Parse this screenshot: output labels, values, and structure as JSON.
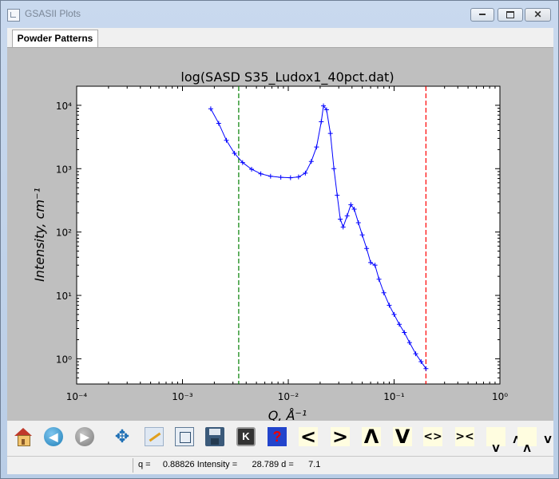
{
  "window": {
    "title": "GSASII Plots"
  },
  "tabs": [
    {
      "label": "Powder Patterns",
      "active": true
    }
  ],
  "status": {
    "text": "q =     0.88826 Intensity =      28.789 d =      7.1"
  },
  "toolbar": {
    "buttons": [
      {
        "name": "home-icon"
      },
      {
        "name": "back-icon"
      },
      {
        "name": "forward-icon"
      },
      {
        "name": "pan-icon"
      },
      {
        "name": "edit-icon"
      },
      {
        "name": "subplots-icon"
      },
      {
        "name": "save-icon"
      },
      {
        "name": "key-icon"
      },
      {
        "name": "help-icon"
      },
      {
        "name": "left-icon",
        "symbol": "<"
      },
      {
        "name": "right-icon",
        "symbol": ">"
      },
      {
        "name": "up-icon",
        "symbol": "Λ"
      },
      {
        "name": "down-icon",
        "symbol": "V"
      },
      {
        "name": "expand-icon",
        "symbol": "<>"
      },
      {
        "name": "shrink-icon",
        "symbol": "><"
      },
      {
        "name": "vexpand-icon",
        "symbol": "Λ\nV"
      },
      {
        "name": "vshrink-icon",
        "symbol": "V\nΛ"
      }
    ],
    "key_label": "K",
    "help_label": "?"
  },
  "chart_data": {
    "type": "line",
    "title": "log(SASD S35_Ludox1_40pct.dat)",
    "xlabel": "Q, Å⁻¹",
    "ylabel": "Intensity, cm⁻¹",
    "xscale": "log",
    "yscale": "log",
    "xlim": [
      0.0001,
      1
    ],
    "ylim": [
      0.4,
      20000
    ],
    "xticks": [
      {
        "value": 0.0001,
        "label": "10⁻⁴"
      },
      {
        "value": 0.001,
        "label": "10⁻³"
      },
      {
        "value": 0.01,
        "label": "10⁻²"
      },
      {
        "value": 0.1,
        "label": "10⁻¹"
      },
      {
        "value": 1,
        "label": "10⁰"
      }
    ],
    "yticks": [
      {
        "value": 1,
        "label": "10⁰"
      },
      {
        "value": 10,
        "label": "10¹"
      },
      {
        "value": 100,
        "label": "10²"
      },
      {
        "value": 1000,
        "label": "10³"
      },
      {
        "value": 10000,
        "label": "10⁴"
      }
    ],
    "series_color": "#0000ff",
    "markers": "+",
    "vlines": [
      {
        "x": 0.0034,
        "color": "#007f00",
        "style": "dashed"
      },
      {
        "x": 0.2,
        "color": "#ff0000",
        "style": "dashed"
      }
    ],
    "x": [
      0.00185,
      0.0022,
      0.0026,
      0.0031,
      0.0037,
      0.0045,
      0.0055,
      0.0068,
      0.0085,
      0.0105,
      0.0125,
      0.0145,
      0.0165,
      0.0185,
      0.0205,
      0.0215,
      0.023,
      0.025,
      0.027,
      0.029,
      0.031,
      0.033,
      0.036,
      0.039,
      0.042,
      0.046,
      0.05,
      0.055,
      0.06,
      0.066,
      0.072,
      0.08,
      0.09,
      0.1,
      0.112,
      0.125,
      0.14,
      0.16,
      0.18,
      0.2
    ],
    "y": [
      8800,
      5200,
      2800,
      1750,
      1250,
      980,
      830,
      760,
      730,
      720,
      740,
      850,
      1300,
      2200,
      5500,
      9800,
      8500,
      3600,
      1000,
      380,
      160,
      120,
      180,
      270,
      230,
      140,
      90,
      55,
      33,
      30,
      18,
      11,
      7,
      5,
      3.5,
      2.6,
      1.8,
      1.2,
      0.9,
      0.7
    ]
  }
}
